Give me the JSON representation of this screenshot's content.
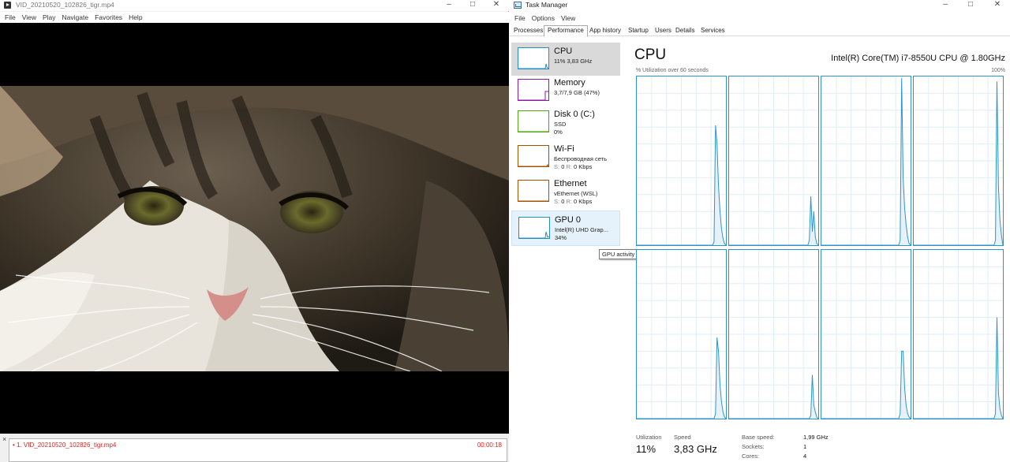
{
  "player": {
    "title": "VID_20210520_102826_tigr.mp4",
    "menu": [
      "File",
      "View",
      "Play",
      "Navigate",
      "Favorites",
      "Help"
    ],
    "playlist": {
      "item_label": "• 1. VID_20210520_102826_tigr.mp4",
      "item_duration": "00:00:18",
      "close_glyph": "×",
      "accent_color": "#e02020"
    }
  },
  "task_manager": {
    "title": "Task Manager",
    "menu": [
      "File",
      "Options",
      "View"
    ],
    "tabs": [
      "Processes",
      "Performance",
      "App history",
      "Startup",
      "Users",
      "Details",
      "Services"
    ],
    "active_tab": "Performance",
    "sidebar": [
      {
        "name": "CPU",
        "line1": "11% 3,83 GHz",
        "color": "#1f8fc4",
        "icon": "cpu-graph-icon"
      },
      {
        "name": "Memory",
        "line1": "3,7/7,9 GB (47%)",
        "color": "#8b1aa5",
        "icon": "memory-graph-icon"
      },
      {
        "name": "Disk 0 (C:)",
        "line1": "SSD",
        "line2": "0%",
        "color": "#4da60c",
        "icon": "disk-graph-icon"
      },
      {
        "name": "Wi-Fi",
        "line1": "Беспроводная сеть",
        "line2_s": "S:",
        "line2_v": "0",
        "line2_r": "R:",
        "line2_rv": "0 Kbps",
        "color": "#a74f01",
        "icon": "wifi-graph-icon"
      },
      {
        "name": "Ethernet",
        "line1": "vEthernet (WSL)",
        "line2_s": "S:",
        "line2_v": "0",
        "line2_r": "R:",
        "line2_rv": "0 Kbps",
        "color": "#a74f01",
        "icon": "ethernet-graph-icon"
      },
      {
        "name": "GPU 0",
        "line1": "Intel(R) UHD Grap...",
        "line2": "34%",
        "color": "#1f8fc4",
        "icon": "gpu-graph-icon"
      }
    ],
    "tooltip": "GPU activity",
    "main": {
      "title": "CPU",
      "model": "Intel(R) Core(TM) i7-8550U CPU @ 1.80GHz",
      "util_label": "% Utilization over 60 seconds",
      "util_max": "100%",
      "graph_color": "#2e93cb",
      "grid_color": "#dfeef7"
    },
    "stats": {
      "utilization_label": "Utilization",
      "utilization_value": "11%",
      "speed_label": "Speed",
      "speed_value": "3,83 GHz",
      "base_speed_label": "Base speed:",
      "base_speed_value": "1,99 GHz",
      "sockets_label": "Sockets:",
      "sockets_value": "1",
      "cores_label": "Cores:",
      "cores_value": "4"
    }
  },
  "chart_data": {
    "type": "line",
    "title": "CPU",
    "xlabel": "% Utilization over 60 seconds",
    "ylim": [
      0,
      100
    ],
    "grid": true,
    "series": [
      {
        "values": [
          0,
          0,
          0,
          0,
          0,
          0,
          0,
          0,
          0,
          0,
          0,
          0,
          0,
          0,
          0,
          0,
          0,
          0,
          0,
          0,
          0,
          0,
          0,
          0,
          0,
          0,
          0,
          0,
          0,
          0,
          0,
          0,
          0,
          0,
          0,
          0,
          0,
          0,
          0,
          0,
          0,
          0,
          0,
          0,
          0,
          0,
          0,
          0,
          0,
          0,
          0,
          0,
          2,
          71,
          60,
          35,
          20,
          10,
          4,
          1,
          0
        ]
      },
      {
        "values": [
          0,
          0,
          0,
          0,
          0,
          0,
          0,
          0,
          0,
          0,
          0,
          0,
          0,
          0,
          0,
          0,
          0,
          0,
          0,
          0,
          0,
          0,
          0,
          0,
          0,
          0,
          0,
          0,
          0,
          0,
          0,
          0,
          0,
          0,
          0,
          0,
          0,
          0,
          0,
          0,
          0,
          0,
          0,
          0,
          0,
          0,
          0,
          0,
          0,
          0,
          0,
          0,
          0,
          0,
          3,
          29,
          8,
          20,
          5,
          1,
          0
        ]
      },
      {
        "values": [
          0,
          0,
          0,
          0,
          0,
          0,
          0,
          0,
          0,
          0,
          0,
          0,
          0,
          0,
          0,
          0,
          0,
          0,
          0,
          0,
          0,
          0,
          0,
          0,
          0,
          0,
          0,
          0,
          0,
          0,
          0,
          0,
          0,
          0,
          0,
          0,
          0,
          0,
          0,
          0,
          0,
          0,
          0,
          0,
          0,
          0,
          0,
          0,
          0,
          0,
          0,
          0,
          0,
          3,
          99,
          40,
          22,
          12,
          5,
          1,
          0
        ]
      },
      {
        "values": [
          0,
          0,
          0,
          0,
          0,
          0,
          0,
          0,
          0,
          0,
          0,
          0,
          0,
          0,
          0,
          0,
          0,
          0,
          0,
          0,
          0,
          0,
          0,
          0,
          0,
          0,
          0,
          0,
          0,
          0,
          0,
          0,
          0,
          0,
          0,
          0,
          0,
          0,
          0,
          0,
          0,
          0,
          0,
          0,
          0,
          0,
          0,
          0,
          0,
          0,
          0,
          0,
          0,
          0,
          0,
          3,
          97,
          35,
          15,
          6,
          0
        ]
      },
      {
        "values": [
          0,
          0,
          0,
          0,
          0,
          0,
          0,
          0,
          0,
          0,
          0,
          0,
          0,
          0,
          0,
          0,
          0,
          0,
          0,
          0,
          0,
          0,
          0,
          0,
          0,
          0,
          0,
          0,
          0,
          0,
          0,
          0,
          0,
          0,
          0,
          0,
          0,
          0,
          0,
          0,
          0,
          0,
          0,
          0,
          0,
          0,
          0,
          0,
          0,
          0,
          0,
          0,
          0,
          3,
          48,
          40,
          20,
          10,
          4,
          1,
          0
        ]
      },
      {
        "values": [
          0,
          0,
          0,
          0,
          0,
          0,
          0,
          0,
          0,
          0,
          0,
          0,
          0,
          0,
          0,
          0,
          0,
          0,
          0,
          0,
          0,
          0,
          0,
          0,
          0,
          0,
          0,
          0,
          0,
          0,
          0,
          0,
          0,
          0,
          0,
          0,
          0,
          0,
          0,
          0,
          0,
          0,
          0,
          0,
          0,
          0,
          0,
          0,
          0,
          0,
          0,
          0,
          0,
          0,
          0,
          2,
          26,
          8,
          4,
          1,
          0
        ]
      },
      {
        "values": [
          0,
          0,
          0,
          0,
          0,
          0,
          0,
          0,
          0,
          0,
          0,
          0,
          0,
          0,
          0,
          0,
          0,
          0,
          0,
          0,
          0,
          0,
          0,
          0,
          0,
          0,
          0,
          0,
          0,
          0,
          0,
          0,
          0,
          0,
          0,
          0,
          0,
          0,
          0,
          0,
          0,
          0,
          0,
          0,
          0,
          0,
          0,
          0,
          0,
          0,
          0,
          0,
          0,
          3,
          40,
          40,
          18,
          8,
          3,
          1,
          0
        ]
      },
      {
        "values": [
          0,
          0,
          0,
          0,
          0,
          0,
          0,
          0,
          0,
          0,
          0,
          0,
          0,
          0,
          0,
          0,
          0,
          0,
          0,
          0,
          0,
          0,
          0,
          0,
          0,
          0,
          0,
          0,
          0,
          0,
          0,
          0,
          0,
          0,
          0,
          0,
          0,
          0,
          0,
          0,
          0,
          0,
          0,
          0,
          0,
          0,
          0,
          0,
          0,
          0,
          0,
          0,
          0,
          0,
          0,
          3,
          60,
          15,
          6,
          2,
          0
        ]
      }
    ]
  }
}
